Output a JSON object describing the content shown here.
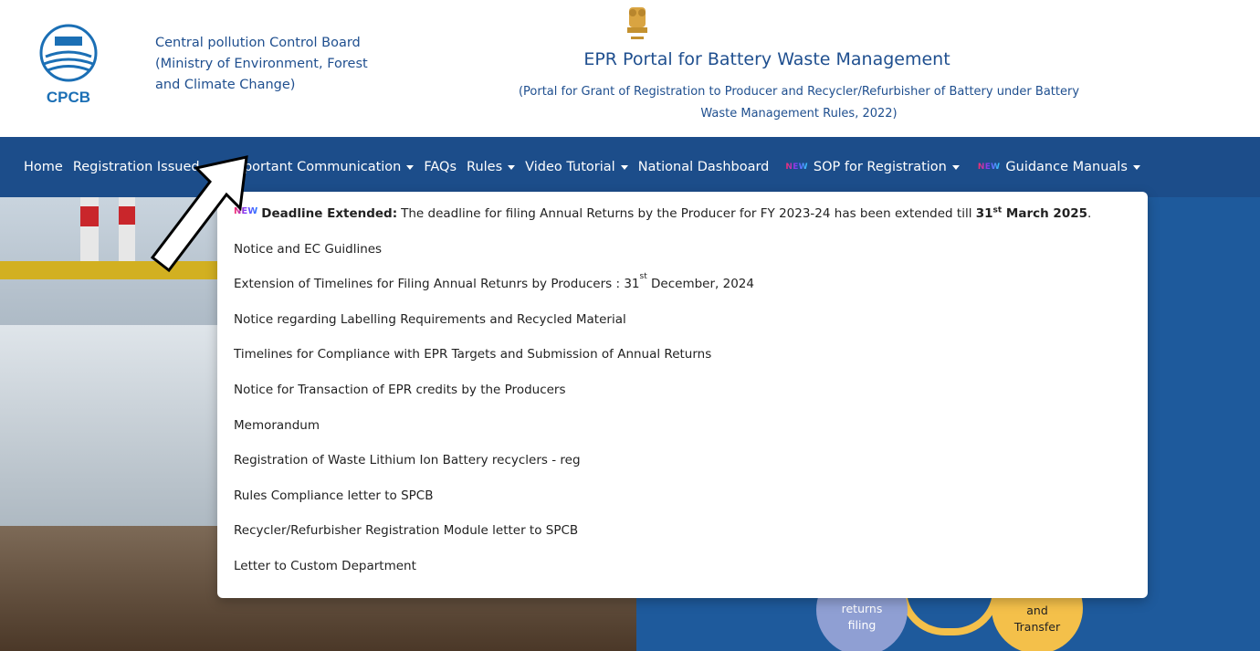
{
  "header": {
    "org_line1": "Central pollution Control Board",
    "org_line2": "(Ministry of Environment, Forest",
    "org_line3": "and Climate Change)",
    "logo_text": "CPCB",
    "portal_title": "EPR Portal for Battery Waste Management",
    "portal_subtitle_line1": "(Portal for Grant of Registration to Producer and Recycler/Refurbisher of Battery under Battery",
    "portal_subtitle_line2": "Waste Management Rules, 2022)"
  },
  "nav": {
    "home": "Home",
    "registration_issued": "Registration Issued",
    "important_communication": "Important Communication",
    "faqs": "FAQs",
    "rules": "Rules",
    "video_tutorial": "Video Tutorial",
    "national_dashboard": "National Dashboard",
    "new_tag": "NEW",
    "sop_registration": "SOP for Registration",
    "guidance_manuals": "Guidance Manuals"
  },
  "dropdown": {
    "new_tag": "NEW",
    "item0_bold": "Deadline Extended:",
    "item0_text": "The deadline for filing Annual Returns by the Producer for FY 2023-24 has been extended till",
    "item0_date_num": "31",
    "item0_date_sup": "st",
    "item0_date_rest": "March 2025",
    "item0_end": ".",
    "item1": "Notice and EC Guidlines",
    "item2_pre": "Extension of Timelines for Filing Annual Retunrs by Producers : 31",
    "item2_sup": "st",
    "item2_post": "December, 2024",
    "item3": "Notice regarding Labelling Requirements and Recycled Material",
    "item4": "Timelines for Compliance with EPR Targets and Submission of Annual Returns",
    "item5": "Notice for Transaction of EPR credits by the Producers",
    "item6": "Memorandum",
    "item7": "Registration of Waste Lithium Ion Battery recyclers - reg",
    "item8": "Rules Compliance letter to SPCB",
    "item9": "Recycler/Refurbisher Registration Module letter to SPCB",
    "item10": "Letter to Custom Department"
  },
  "diagram": {
    "circle_a_line1": "returns",
    "circle_a_line2": "filing",
    "circle_b_line1": "and",
    "circle_b_line2": "Transfer"
  },
  "colors": {
    "navbar": "#1c4d8a",
    "header_text": "#1f4f8f",
    "accent_yellow": "#f4c04a",
    "accent_lavender": "#8f9fd3"
  }
}
